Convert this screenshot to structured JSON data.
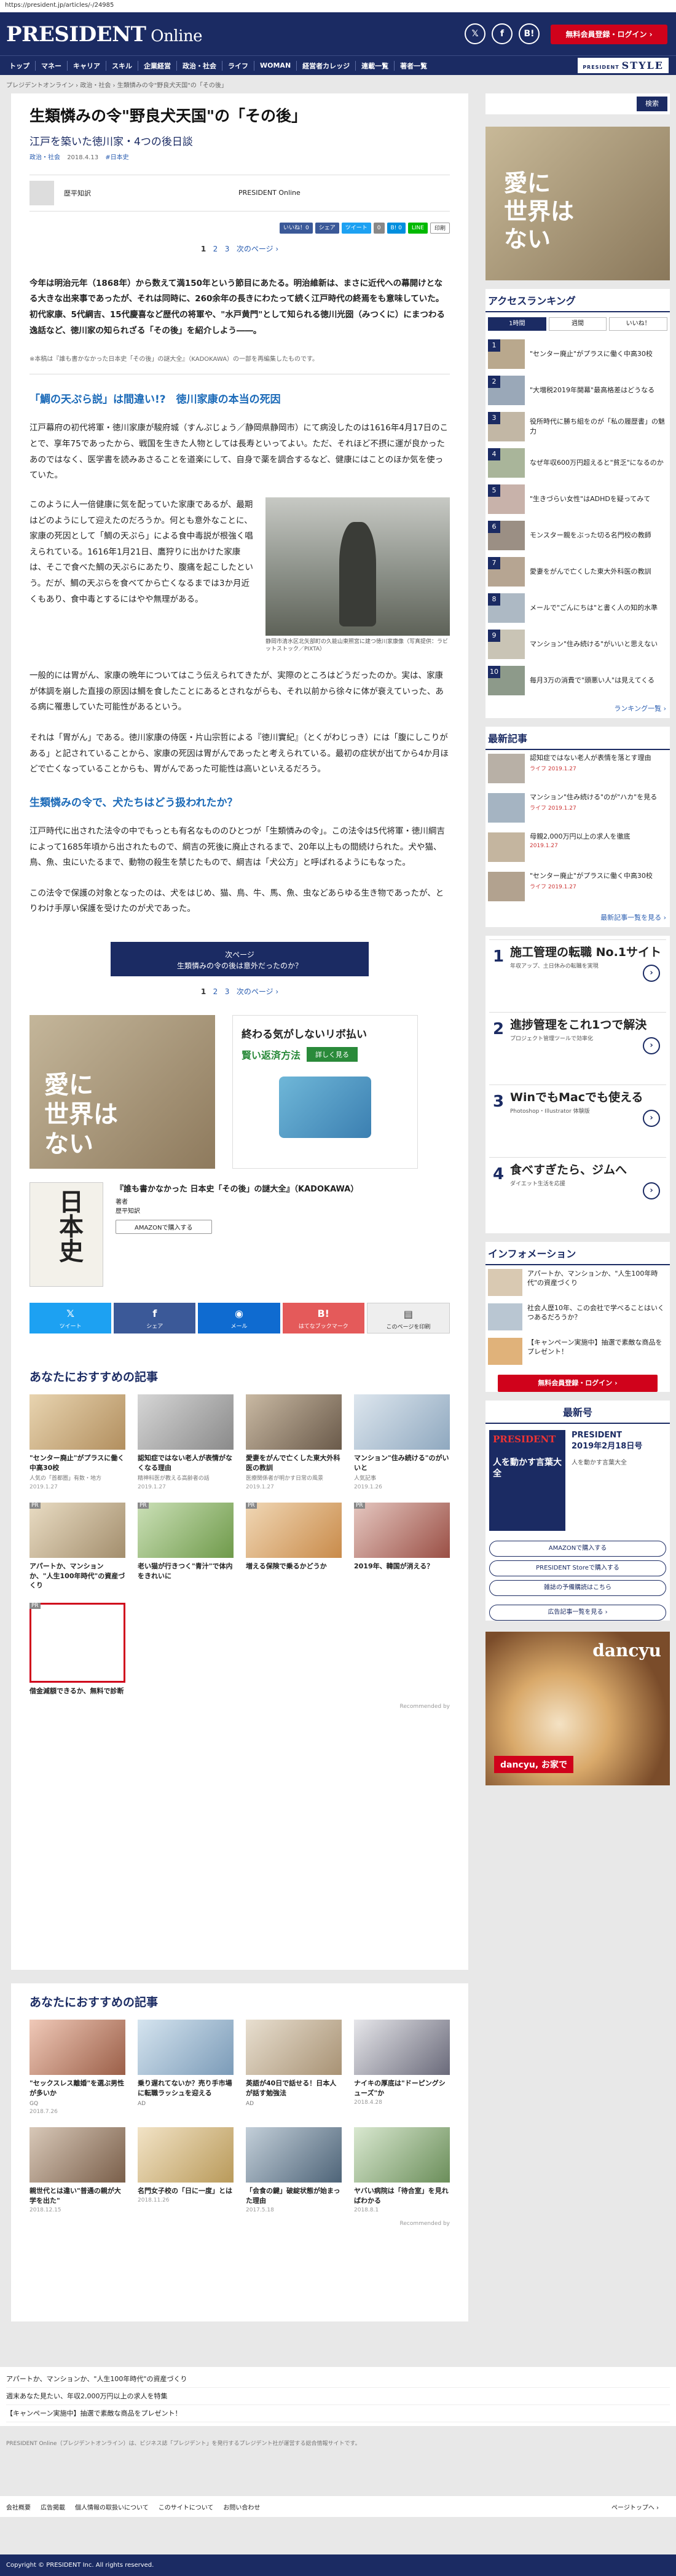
{
  "url": "https://president.jp/articles/-/24985",
  "header": {
    "logo": "PRESIDENT",
    "logo2": " Online",
    "social": [
      "𝕏",
      "f",
      "B!"
    ],
    "register": "無料会員登録・ログイン ›"
  },
  "nav": [
    "トップ",
    "マネー",
    "キャリア",
    "スキル",
    "企業経営",
    "政治・社会",
    "ライフ",
    "WOMAN",
    "経営者カレッジ",
    "連載一覧",
    "著者一覧"
  ],
  "style_logo": "STYLE",
  "style_prefix": "PRESIDENT",
  "breadcrumb": "プレジデントオンライン › 政治・社会 › 生類憐みの令\"野良犬天国\"の「その後」",
  "article": {
    "title": "生類憐みの令\"野良犬天国\"の「その後」",
    "subtitle": "江戸を築いた徳川家・4つの後日談",
    "cat1": "政治・社会",
    "date": "2018.4.13",
    "tag": "#日本史",
    "author1": "歴平知訳",
    "author2": "PRESIDENT Online",
    "share": [
      "いいね！0",
      "シェア",
      "ツイート",
      "0",
      "B! 0",
      "LINE",
      "印刷"
    ],
    "pager": [
      "1",
      "2",
      "3",
      "次のページ ›"
    ],
    "lead": "今年は明治元年（1868年）から数えて満150年という節目にあたる。明治維新は、まさに近代への幕開けとなる大きな出来事であったが、それは同時に、260余年の長きにわたって続く江戸時代の終焉をも意味していた。初代家康、5代綱吉、15代慶喜など歴代の将軍や、\"水戸黄門\"として知られる徳川光圀（みつくに）にまつわる逸話など、徳川家の知られざる「その後」を紹介しよう――。",
    "note": "※本稿は『誰も書かなかった日本史「その後」の謎大全』（KADOKAWA）の一部を再編集したものです。",
    "h2a": "「鯛の天ぷら説」は間違い!?　徳川家康の本当の死因",
    "p1": "江戸幕府の初代将軍・徳川家康が駿府城（すんぷじょう／静岡県静岡市）にて病没したのは1616年4月17日のことで、享年75であったから、戦国を生きた人物としては長寿といってよい。ただ、それほど不摂に運が良かったあのではなく、医学書を読みあさることを道楽にして、自身で薬を調合するなど、健康にはことのほか気を使っていた。",
    "p2": "このように人一倍健康に気を配っていた家康であるが、最期はどのようにして迎えたのだろうか。何とも意外なことに、家康の死因として「鯛の天ぷら」による食中毒説が根強く唱えられている。1616年1月21日、鷹狩りに出かけた家康は、そこで食べた鯛の天ぷらにあたり、腹痛を起こしたという。だが、鯛の天ぷらを食べてから亡くなるまでは3か月近くもあり、食中毒とするにはやや無理がある。",
    "fig_caption": "静岡市清水区北矢部町の久能山東照宮に建つ徳川家康像（写真提供：ラビットストック／PIXTA）",
    "p3": "一般的には胃がん、家康の晩年についてはこう伝えられてきたが、実際のところはどうだったのか。実は、家康が体調を崩した直接の原因は鯛を食したことにあるとされながらも、それ以前から徐々に体が衰えていった、ある病に罹患していた可能性があるという。",
    "p4": "それは「胃がん」である。徳川家康の侍医・片山宗哲による『徳川實紀』（とくがわじっき）には「腹にしこりがある」と記されていることから、家康の死因は胃がんであったと考えられている。最初の症状が出てから4か月ほどで亡くなっていることからも、胃がんであった可能性は高いといえるだろう。",
    "h2b": "生類憐みの令で、犬たちはどう扱われたか？",
    "p5": "江戸時代に出された法令の中でもっとも有名なもののひとつが「生類憐みの令」。この法令は5代将軍・徳川綱吉によって1685年頃から出されたもので、綱吉の死後に廃止されるまで、20年以上もの間続けられた。犬や猫、鳥、魚、虫にいたるまで、動物の殺生を禁じたもので、綱吉は「犬公方」と呼ばれるようにもなった。",
    "p6": "この法令で保護の対象となったのは、犬をはじめ、猫、鳥、牛、馬、魚、虫などあらゆる生き物であったが、とりわけ手厚い保護を受けたのが犬であった。",
    "next": "次ページ",
    "next_title": "生類憐みの令の後は意外だったのか？",
    "ad2_title": "終わる気がしないリボ払い",
    "ad2_sub": "賢い返済方法",
    "ad2_btn": "詳しく見る",
    "ad1_text": "愛に\n世界は\nない",
    "book_title": "『誰も書かなかった 日本史「その後」の謎大全』（KADOKAWA）",
    "book_sub": "著者",
    "book_author": "歴平知訳",
    "book_cover": "日本史",
    "amazon": "AMAZONで購入する",
    "share_big": [
      {
        "ic": "𝕏",
        "label": "ツイート"
      },
      {
        "ic": "f",
        "label": "シェア"
      },
      {
        "ic": "◉",
        "label": "メール"
      },
      {
        "ic": "B!",
        "label": "はてなブックマーク"
      },
      {
        "ic": "▤",
        "label": "このページを印刷"
      }
    ]
  },
  "rec1": {
    "title": "あなたにおすすめの記事",
    "items": [
      {
        "t": "\"センター廃止\"がプラスに働く中高30校",
        "s": "人気の「首都圏」有数・地方",
        "d": "2019.1.27"
      },
      {
        "t": "認知症ではない老人が表情がなくなる理由",
        "s": "精神科医が教える高齢者の話",
        "d": "2019.1.27"
      },
      {
        "t": "愛妻をがんで亡くした東大外科医の教訓",
        "s": "医療関係者が明かす日常の風景",
        "d": "2019.1.27"
      },
      {
        "t": "マンション\"住み続ける\"のがいいと",
        "s": "人気記事",
        "d": "2019.1.26"
      },
      {
        "t": "アパートか、マンションか、\"人生100年時代\"の資産づくり",
        "s": "PR",
        "d": ""
      },
      {
        "t": "老い猫が行きつく\"青汁\"で体内をきれいに",
        "s": "PR",
        "d": ""
      },
      {
        "t": "増える保険で乗るかどうか",
        "s": "PR",
        "d": ""
      },
      {
        "t": "2019年、韓国が消える？",
        "s": "PR",
        "d": ""
      },
      {
        "t": "借金減額できるか、無料で診断",
        "s": "PR",
        "d": ""
      }
    ]
  },
  "rec2": {
    "title": "あなたにおすすめの記事",
    "items": [
      {
        "t": "\"セックスレス離婚\"を選ぶ男性が多いか",
        "s": "GQ",
        "d": "2018.7.26"
      },
      {
        "t": "乗り遅れてないか？売り手市場に転職ラッシュを迎える",
        "s": "AD",
        "d": ""
      },
      {
        "t": "英語が40日で話せる！日本人が話す勉強法",
        "s": "AD",
        "d": ""
      },
      {
        "t": "ナイキの厚底は\"ドーピングシューズ\"か",
        "s": "",
        "d": "2018.4.28"
      },
      {
        "t": "親世代とは違い\"普通の親が大学を出た\"",
        "s": "",
        "d": "2018.12.15"
      },
      {
        "t": "名門女子校の「日に一度」とは",
        "s": "",
        "d": "2018.11.26"
      },
      {
        "t": "「会食の鍵」破綻状態が始まった理由",
        "s": "",
        "d": "2017.5.18"
      },
      {
        "t": "ヤバい病院は「待合室」を見ればわかる",
        "s": "",
        "d": "2018.8.1"
      }
    ]
  },
  "recommended_by": "Recommended by",
  "side": {
    "search": "検索",
    "ad_text": "愛に\n世界は\nない",
    "ranking_title": "アクセスランキング",
    "tabs": [
      "1時間",
      "週間",
      "いいね！"
    ],
    "ranks": [
      "\"センター廃止\"がプラスに働く中高30校",
      "\"大増税2019年開幕\"最高格差はどうなる",
      "役所時代に勝ち組をのが「私の履歴書」の魅力",
      "なぜ年収600万円超えると\"貧乏\"になるのか",
      "\"生きづらい女性\"はADHDを疑ってみて",
      "モンスター親をぶった切る名門校の教師",
      "愛妻をがんで亡くした東大外科医の教訓",
      "メールで\"ごんにちは\"と書く人の知的水準",
      "マンション\"住み続ける\"がいいと思えない",
      "毎月3万の消費で\"頭悪い人\"は見えてくる"
    ],
    "rank_more": "ランキング一覧 ›",
    "latest_title": "最新記事",
    "latest": [
      {
        "t": "認知症ではない老人が表情を落とす理由",
        "d": "ライフ 2019.1.27"
      },
      {
        "t": "マンション\"住み続ける\"のが\"ハカ\"を見る",
        "d": "ライフ 2019.1.27"
      },
      {
        "t": "母親2,000万円以上の求人を徹底",
        "d": "2019.1.27"
      },
      {
        "t": "\"センター廃止\"がプラスに働く中高30校",
        "d": "ライフ 2019.1.27"
      }
    ],
    "latest_more": "最新記事一覧を見る ›",
    "bigads": [
      {
        "n": "1",
        "t": "施工管理の転職 No.1サイト",
        "d": "年収アップ、土日休みの転職を実現"
      },
      {
        "n": "2",
        "t": "進捗管理をこれ1つで解決",
        "d": "プロジェクト管理ツールで効率化"
      },
      {
        "n": "3",
        "t": "WinでもMacでも使える",
        "d": "Photoshop・Illustrator 体験版"
      },
      {
        "n": "4",
        "t": "食べすぎたら、ジムへ",
        "d": "ダイエット生活を応援"
      }
    ],
    "info_title": "インフォメーション",
    "info": [
      "アパートか、マンションか、\"人生100年時代\"の資産づくり",
      "社会人歴10年、この会社で学べることはいくつあるだろうか？",
      "【キャンペーン実施中】抽選で素敵な商品をプレゼント！"
    ],
    "register": "無料会員登録・ログイン ›",
    "mag_title": "最新号",
    "mag_cover": "PRESIDENT",
    "mag_head": "人を動かす言葉大全",
    "mag_name": "PRESIDENT\n2019年2月18日号",
    "mag_desc": "人を動かす言葉大全",
    "buttons": [
      "AMAZONで購入する",
      "PRESIDENT Storeで購入する",
      "雑誌の予備購読はこちら"
    ],
    "ad_list": "広告記事一覧を見る ›",
    "dancyu_title": "dancyu",
    "dancyu_badge": "dancyu, お家で"
  },
  "footer": {
    "links": [
      "アパートか、マンションか、\"人生100年時代\"の資産づくり",
      "週末あなた見たい、年収2,000万円以上の求人を特集",
      "【キャンペーン実施中】抽選で素敵な商品をプレゼント！"
    ],
    "text": "PRESIDENT Online（プレジデントオンライン）は、ビジネス誌「プレジデント」を発行するプレジデント社が運営する総合情報サイトです。",
    "nav": [
      "会社概要",
      "広告掲載",
      "個人情報の取扱いについて",
      "このサイトについて",
      "お問い合わせ"
    ],
    "pagetop": "ページトップへ ›",
    "copy": "Copyright © PRESIDENT Inc. All rights reserved."
  }
}
